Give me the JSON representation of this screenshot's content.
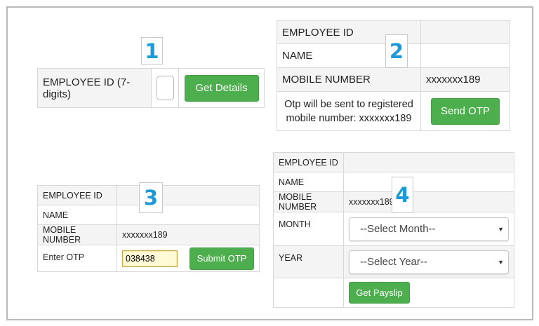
{
  "badges": [
    "1",
    "2",
    "3",
    "4"
  ],
  "panel1": {
    "employee_id_label": "EMPLOYEE ID (7-digits)",
    "employee_id_value": "",
    "get_details_button": "Get Details"
  },
  "panel2": {
    "employee_id_label": "EMPLOYEE ID",
    "employee_id_value": "",
    "name_label": "NAME",
    "name_value": "",
    "mobile_label": "MOBILE NUMBER",
    "mobile_value": "xxxxxxx189",
    "otp_note_line1": "Otp will be sent to registered",
    "otp_note_line2": "mobile number: xxxxxxx189",
    "send_otp_button": "Send OTP"
  },
  "panel3": {
    "employee_id_label": "EMPLOYEE ID",
    "name_label": "NAME",
    "mobile_label": "MOBILE NUMBER",
    "mobile_value": "xxxxxxx189",
    "otp_label": "Enter OTP",
    "otp_value": "038438",
    "submit_otp_button": "Submit OTP"
  },
  "panel4": {
    "employee_id_label": "EMPLOYEE ID",
    "name_label": "NAME",
    "mobile_label": "MOBILE NUMBER",
    "mobile_value": "xxxxxxx189",
    "month_label": "MONTH",
    "month_select": "--Select Month--",
    "year_label": "YEAR",
    "year_select": "--Select Year--",
    "get_payslip_button": "Get Payslip"
  },
  "colors": {
    "button_green": "#4cae4c",
    "badge_blue": "#1a9ad6",
    "label_bg": "#f4f4f4",
    "otp_field_bg": "#fffbd6"
  },
  "icons": {
    "dropdown": "caret-down-icon"
  }
}
